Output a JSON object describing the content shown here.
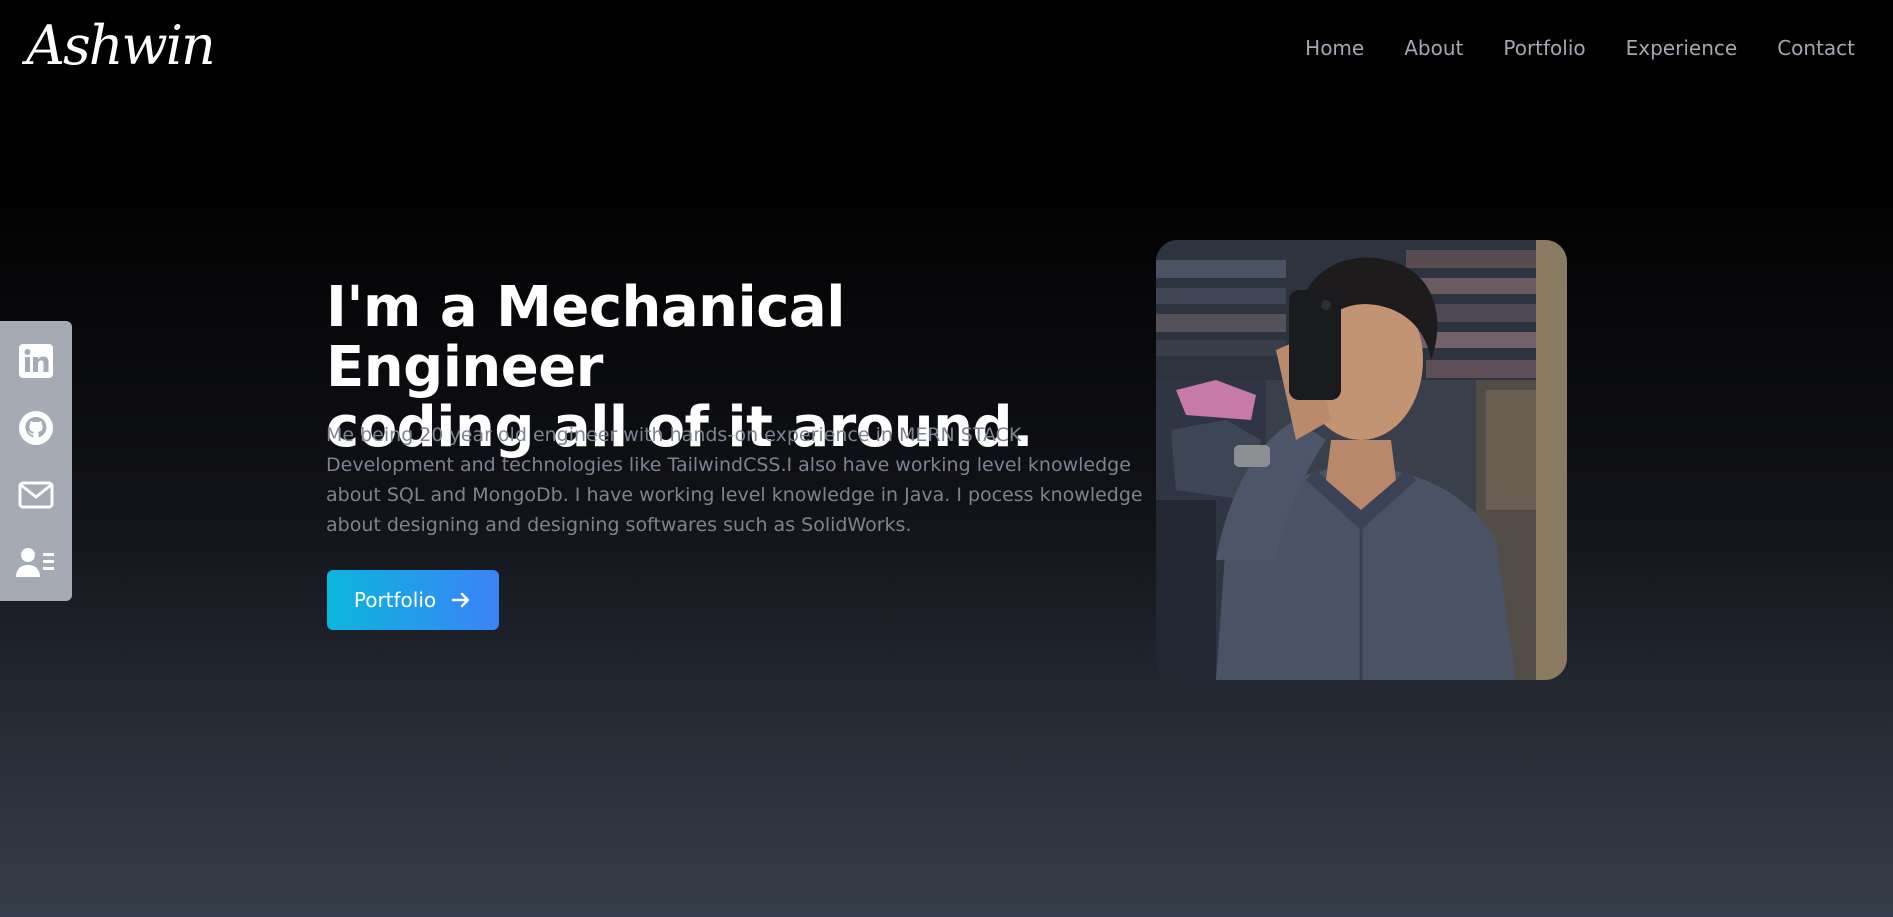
{
  "brand": {
    "logo_text": "Ashwin"
  },
  "nav": {
    "items": [
      {
        "label": "Home"
      },
      {
        "label": "About"
      },
      {
        "label": "Portfolio"
      },
      {
        "label": "Experience"
      },
      {
        "label": "Contact"
      }
    ]
  },
  "social": {
    "icons": [
      "linkedin-icon",
      "github-icon",
      "mail-icon",
      "resume-icon"
    ]
  },
  "hero": {
    "headline_line1": "I'm a Mechanical Engineer",
    "headline_line2": "coding all of it around.",
    "description": "Me being 20 year old engineer with hands-on experience in MERN STACK Development and technologies like TailwindCSS.I also have working level knowledge about SQL and MongoDb. I have working level knowledge in Java. I pocess knowledge about designing and designing softwares such as SolidWorks.",
    "cta_label": "Portfolio"
  },
  "colors": {
    "accent_start": "#0bb6dd",
    "accent_end": "#3b82f6",
    "sidebar": "#a6aab4",
    "nav_text": "#a3a7b1"
  }
}
